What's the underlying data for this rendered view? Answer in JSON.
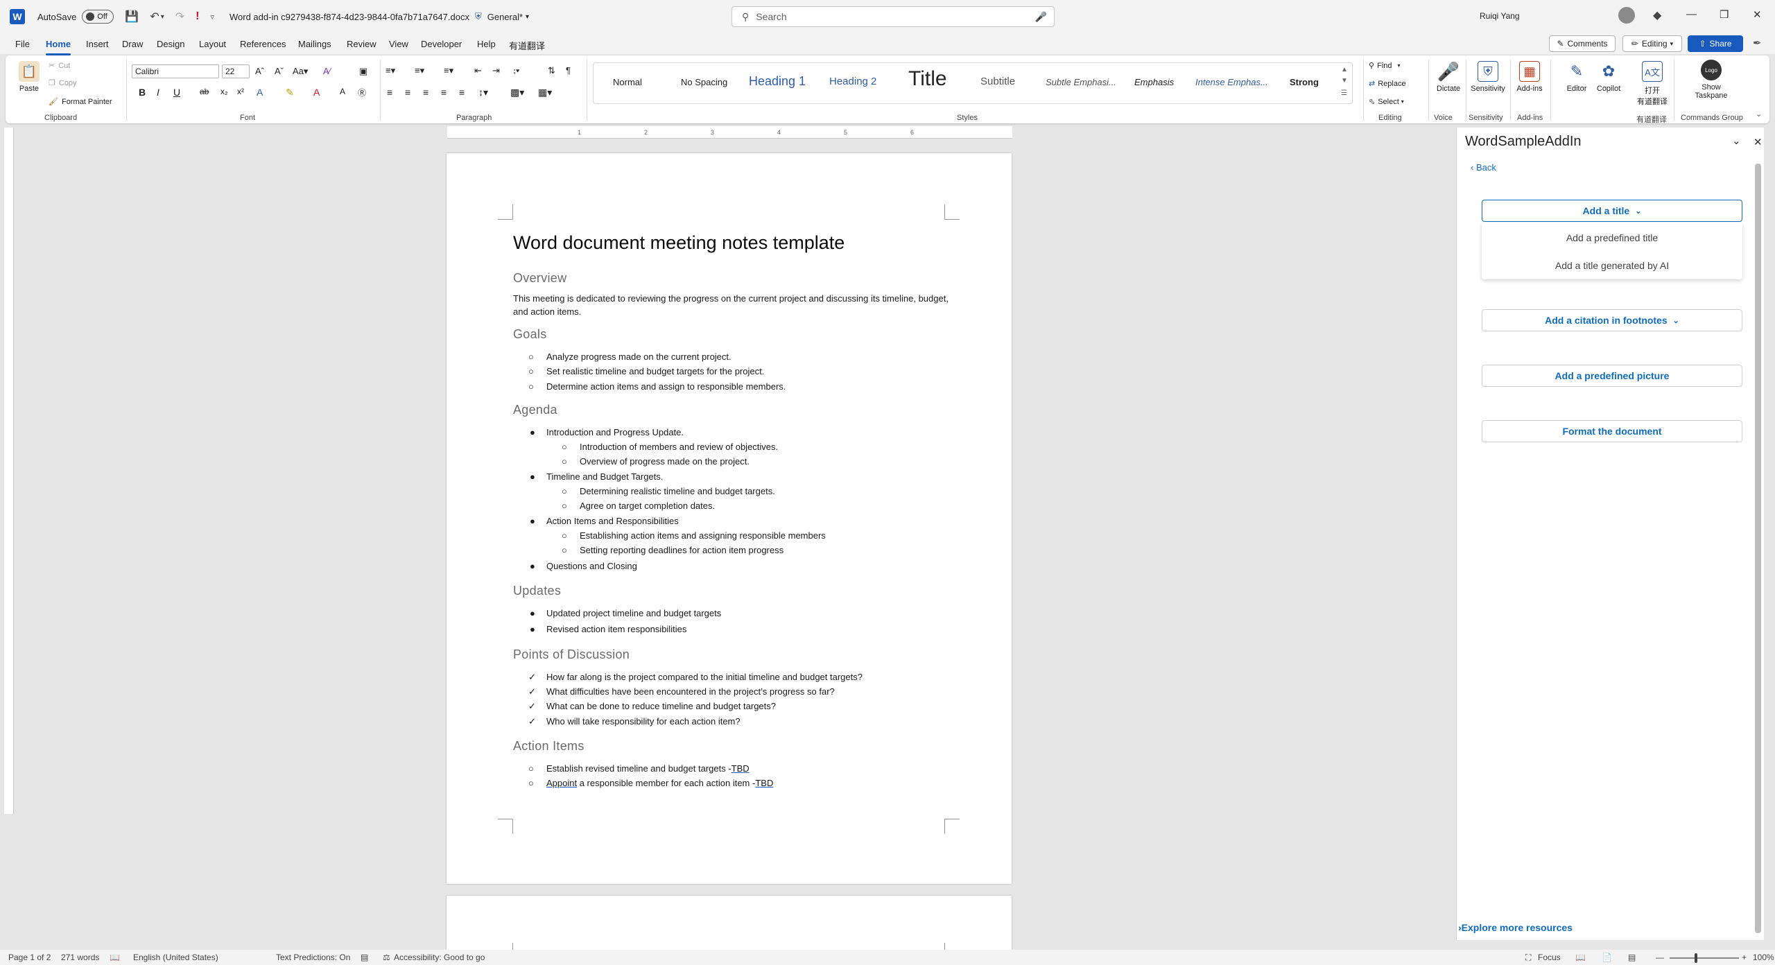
{
  "titlebar": {
    "autosave_label": "AutoSave",
    "autosave_state": "Off",
    "doc_title": "Word add-in c9279438-f874-4d23-9844-0fa7b71a7647.docx",
    "sensitivity": "General*",
    "search_placeholder": "Search",
    "user_name": "Ruiqi Yang",
    "icons": [
      "word-logo",
      "save-icon",
      "undo-icon",
      "redo-icon",
      "alert-icon",
      "customize-icon",
      "search-icon",
      "mic-icon",
      "diamond-icon",
      "minimize-icon",
      "restore-icon",
      "close-icon"
    ]
  },
  "menu": {
    "tabs": [
      "File",
      "Home",
      "Insert",
      "Draw",
      "Design",
      "Layout",
      "References",
      "Mailings",
      "Review",
      "View",
      "Developer",
      "Help",
      "有道翻译"
    ],
    "active": "Home",
    "comments": "Comments",
    "editing": "Editing",
    "share": "Share"
  },
  "ribbon": {
    "clipboard": {
      "paste": "Paste",
      "cut": "Cut",
      "copy": "Copy",
      "format_painter": "Format Painter",
      "label": "Clipboard"
    },
    "font": {
      "name": "Calibri",
      "size": "22",
      "label": "Font"
    },
    "paragraph": {
      "label": "Paragraph"
    },
    "styles": {
      "label": "Styles",
      "items": [
        "Normal",
        "No Spacing",
        "Heading 1",
        "Heading 2",
        "Title",
        "Subtitle",
        "Subtle Emphasi...",
        "Emphasis",
        "Intense Emphas...",
        "Strong"
      ]
    },
    "editing": {
      "find": "Find",
      "replace": "Replace",
      "select": "Select",
      "label": "Editing"
    },
    "voice": {
      "dictate": "Dictate",
      "label": "Voice"
    },
    "sensitivity": {
      "button": "Sensitivity",
      "label": "Sensitivity"
    },
    "addins": {
      "button": "Add-ins",
      "label": "Add-ins"
    },
    "editor": "Editor",
    "copilot": "Copilot",
    "youdao": {
      "line1": "打开",
      "line2": "有道翻译",
      "label": "有道翻译"
    },
    "commands": {
      "logo": "Logo",
      "line1": "Show",
      "line2": "Taskpane",
      "label": "Commands Group"
    }
  },
  "ruler": {
    "ticks": [
      "1",
      "2",
      "3",
      "4",
      "5",
      "6"
    ]
  },
  "document": {
    "title": "Word document meeting notes template",
    "overview_heading": "Overview",
    "overview_text": "This meeting is dedicated to reviewing the progress on the current project and discussing its timeline, budget, and action items.",
    "goals_heading": "Goals",
    "goals": [
      "Analyze progress made on the current project.",
      "Set realistic timeline and budget targets for the project.",
      "Determine action items and assign to responsible members."
    ],
    "agenda_heading": "Agenda",
    "agenda": [
      "Introduction and Progress Update.",
      "Introduction of members and review of objectives.",
      "Overview of progress made on the project.",
      "Timeline and Budget Targets.",
      "Determining realistic timeline and budget targets.",
      "Agree on target completion dates.",
      "Action Items and Responsibilities",
      "Establishing action items and assigning responsible members",
      "Setting reporting deadlines for action item progress",
      "Questions and Closing"
    ],
    "updates_heading": "Updates",
    "updates": [
      "Updated project timeline and budget targets",
      "Revised action item responsibilities"
    ],
    "discussion_heading": "Points of Discussion",
    "discussion": [
      "How far along is the project compared to the initial timeline and budget targets?",
      "What difficulties have been encountered in the project’s progress so far?",
      "What can be done to reduce timeline and budget targets?",
      "Who will take responsibility for each action item?"
    ],
    "actions_heading": "Action Items",
    "actions": [
      {
        "text": "Establish revised timeline and budget targets -",
        "tbd": "TBD"
      },
      {
        "pre": "Appoint",
        "text": " a responsible member for each action item -",
        "tbd": "TBD"
      }
    ]
  },
  "taskpane": {
    "title": "WordSampleAddIn",
    "back": "Back",
    "add_title": "Add a title",
    "title_options": [
      "Add a predefined title",
      "Add a title generated by AI"
    ],
    "add_citation": "Add a citation in footnotes",
    "add_picture": "Add a predefined picture",
    "format_doc": "Format the document",
    "explore": "Explore more resources"
  },
  "status": {
    "page": "Page 1 of 2",
    "words": "271 words",
    "language": "English (United States)",
    "predictions": "Text Predictions: On",
    "accessibility": "Accessibility: Good to go",
    "focus": "Focus",
    "zoom": "100%"
  }
}
